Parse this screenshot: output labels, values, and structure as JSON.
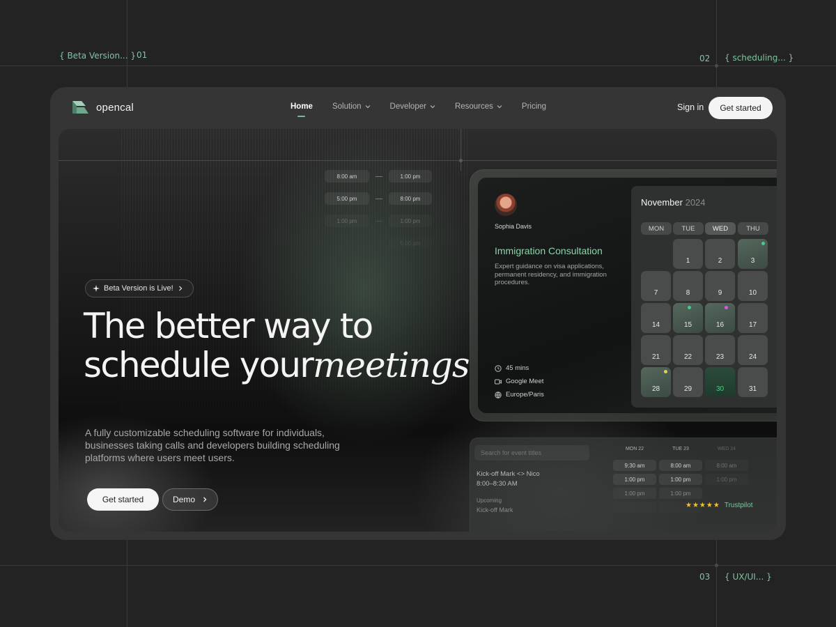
{
  "annotations": {
    "beta": "{ Beta Version... }",
    "n01": "01",
    "n02": "02",
    "scheduling": "{ scheduling... }",
    "n03": "03",
    "uxui": "{ UX/UI... }"
  },
  "nav": {
    "logo_text": "opencal",
    "items": [
      {
        "label": "Home"
      },
      {
        "label": "Solution"
      },
      {
        "label": "Developer"
      },
      {
        "label": "Resources"
      },
      {
        "label": "Pricing"
      }
    ],
    "active": "Home",
    "sign_in": "Sign in",
    "get_started": "Get started"
  },
  "hero": {
    "badge": "Beta Version is Live!",
    "title_line1": "The better way to",
    "title_line2_plain": "schedule your",
    "title_line2_italic": "meetings",
    "description": "A fully customizable scheduling software for individuals, businesses taking calls and developers building scheduling platforms where users meet users.",
    "primary_cta": "Get started",
    "secondary_cta": "Demo"
  },
  "time_slots": [
    {
      "from": "8:00 am",
      "to": "1:00 pm"
    },
    {
      "from": "5:00 pm",
      "to": "8:00 pm"
    },
    {
      "from": "1:00 pm",
      "to": "1:00 pm"
    },
    {
      "from": "",
      "to": "5:00 pm"
    }
  ],
  "booking": {
    "person": "Sophia Davis",
    "title": "Immigration Consultation",
    "description": "Expert guidance on visa applications, permanent residency, and immigration procedures.",
    "duration": "45 mins",
    "location": "Google Meet",
    "timezone": "Europe/Paris"
  },
  "calendar": {
    "month": "November",
    "year": "2024",
    "weekdays": [
      "MON",
      "TUE",
      "WED",
      "THU"
    ],
    "active_weekday": "WED",
    "days": [
      "1",
      "2",
      "3",
      "7",
      "8",
      "9",
      "10",
      "14",
      "15",
      "16",
      "17",
      "21",
      "22",
      "23",
      "24",
      "28",
      "29",
      "30",
      "31"
    ],
    "selected_day": "30",
    "dot_colors": {
      "teal": "#3ecf8e",
      "pink": "#d65ad9",
      "yellow": "#e7d145"
    }
  },
  "events_panel": {
    "search_placeholder": "Search for event titles",
    "event_title": "Kick-off Mark <> Nico",
    "event_time": "8:00–8:30 AM",
    "upcoming_label": "Upcoming",
    "upcoming_event": "Kick-off Mark",
    "columns": [
      "MON 22",
      "TUE 23",
      "WED 24"
    ],
    "rows": [
      [
        "9:30 am",
        "8:00 am",
        "8:00 am"
      ],
      [
        "1:00 pm",
        "1:00 pm",
        "1:00 pm"
      ],
      [
        "1:00 pm",
        "1:00 pm",
        ""
      ],
      [
        "",
        "",
        ""
      ]
    ],
    "trust": "Trustpilot",
    "rating_stars": 5
  },
  "colors": {
    "accent": "#6fbf97",
    "background": "#232323",
    "frame": "#353535"
  }
}
